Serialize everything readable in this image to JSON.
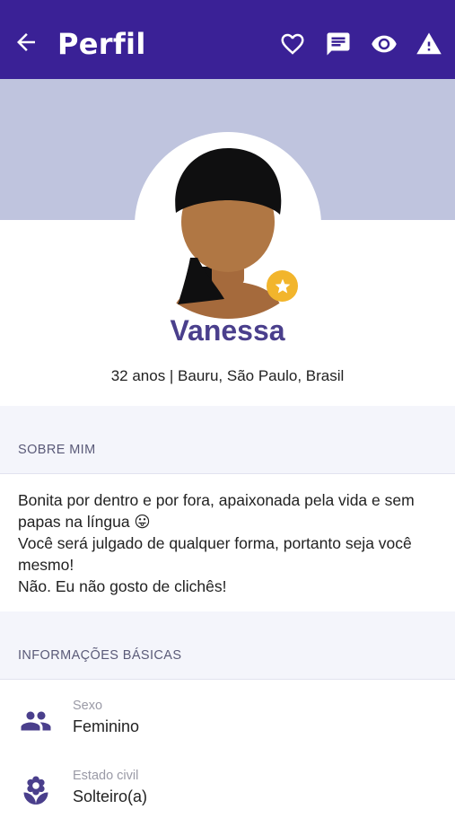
{
  "header": {
    "title": "Perfil",
    "accent_color": "#3a2196",
    "icons": [
      "back-arrow-icon",
      "heart-icon",
      "chat-icon",
      "eye-icon",
      "warning-icon"
    ]
  },
  "profile": {
    "name": "Vanessa",
    "details": "32 anos | Bauru, São Paulo, Brasil",
    "badge_icon": "star-icon"
  },
  "about": {
    "heading": "SOBRE MIM",
    "lines": [
      "Bonita por dentro e por fora, apaixonada pela vida e sem papas na língua 😛",
      "Você será julgado de qualquer forma, portanto seja você mesmo!",
      "Não. Eu não gosto de clichês!"
    ]
  },
  "basic_info": {
    "heading": "INFORMAÇÕES BÁSICAS",
    "items": [
      {
        "label": "Sexo",
        "value": "Feminino",
        "icon": "people-icon"
      },
      {
        "label": "Estado civil",
        "value": "Solteiro(a)",
        "icon": "flower-icon"
      }
    ]
  }
}
